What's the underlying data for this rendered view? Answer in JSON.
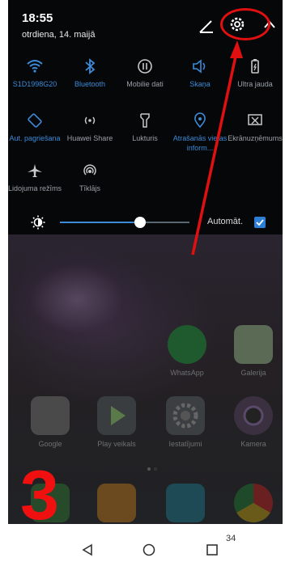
{
  "status": {
    "time": "18:55",
    "date": "otrdiena, 14. maijā"
  },
  "tiles": [
    {
      "label": "S1D1998G20",
      "icon": "wifi-icon",
      "active": true
    },
    {
      "label": "Bluetooth",
      "icon": "bluetooth-icon",
      "active": true
    },
    {
      "label": "Mobilie dati",
      "icon": "mobile-data-icon",
      "active": false
    },
    {
      "label": "Skaņa",
      "icon": "sound-icon",
      "active": true
    },
    {
      "label": "Ultra jauda",
      "icon": "battery-icon",
      "active": false
    },
    {
      "label": "Aut. pagriešana",
      "icon": "auto-rotate-icon",
      "active": true
    },
    {
      "label": "Huawei Share",
      "icon": "huawei-share-icon",
      "active": false
    },
    {
      "label": "Lukturis",
      "icon": "flashlight-icon",
      "active": false
    },
    {
      "label": "Atrašanās vietas inform...",
      "icon": "location-icon",
      "active": true
    },
    {
      "label": "Ekrānuzņēmums",
      "icon": "screenshot-icon",
      "active": false
    },
    {
      "label": "Lidojuma režīms",
      "icon": "airplane-icon",
      "active": false
    },
    {
      "label": "Tīklājs",
      "icon": "hotspot-icon",
      "active": false
    }
  ],
  "brightness": {
    "level": 0.62,
    "auto_label": "Automāt.",
    "auto_checked": true
  },
  "apps": [
    {
      "name": "WhatsApp",
      "icon": "whatsapp-icon"
    },
    {
      "name": "Galerija",
      "icon": "gallery-icon"
    },
    {
      "name": "Google",
      "icon": "google-folder-icon"
    },
    {
      "name": "Play veikals",
      "icon": "play-store-icon"
    },
    {
      "name": "Iestatījumi",
      "icon": "settings-app-icon"
    },
    {
      "name": "Kamera",
      "icon": "camera-icon"
    }
  ],
  "dock": [
    {
      "icon": "phone-icon"
    },
    {
      "icon": "contacts-icon"
    },
    {
      "icon": "messages-icon"
    },
    {
      "icon": "chrome-icon"
    }
  ],
  "annotation": {
    "step_number": "3",
    "color": "#e01010"
  },
  "page_number": "34",
  "colors": {
    "accent": "#3d8bd8",
    "inactive": "#9aa0a6",
    "panel_bg": "#050709"
  }
}
